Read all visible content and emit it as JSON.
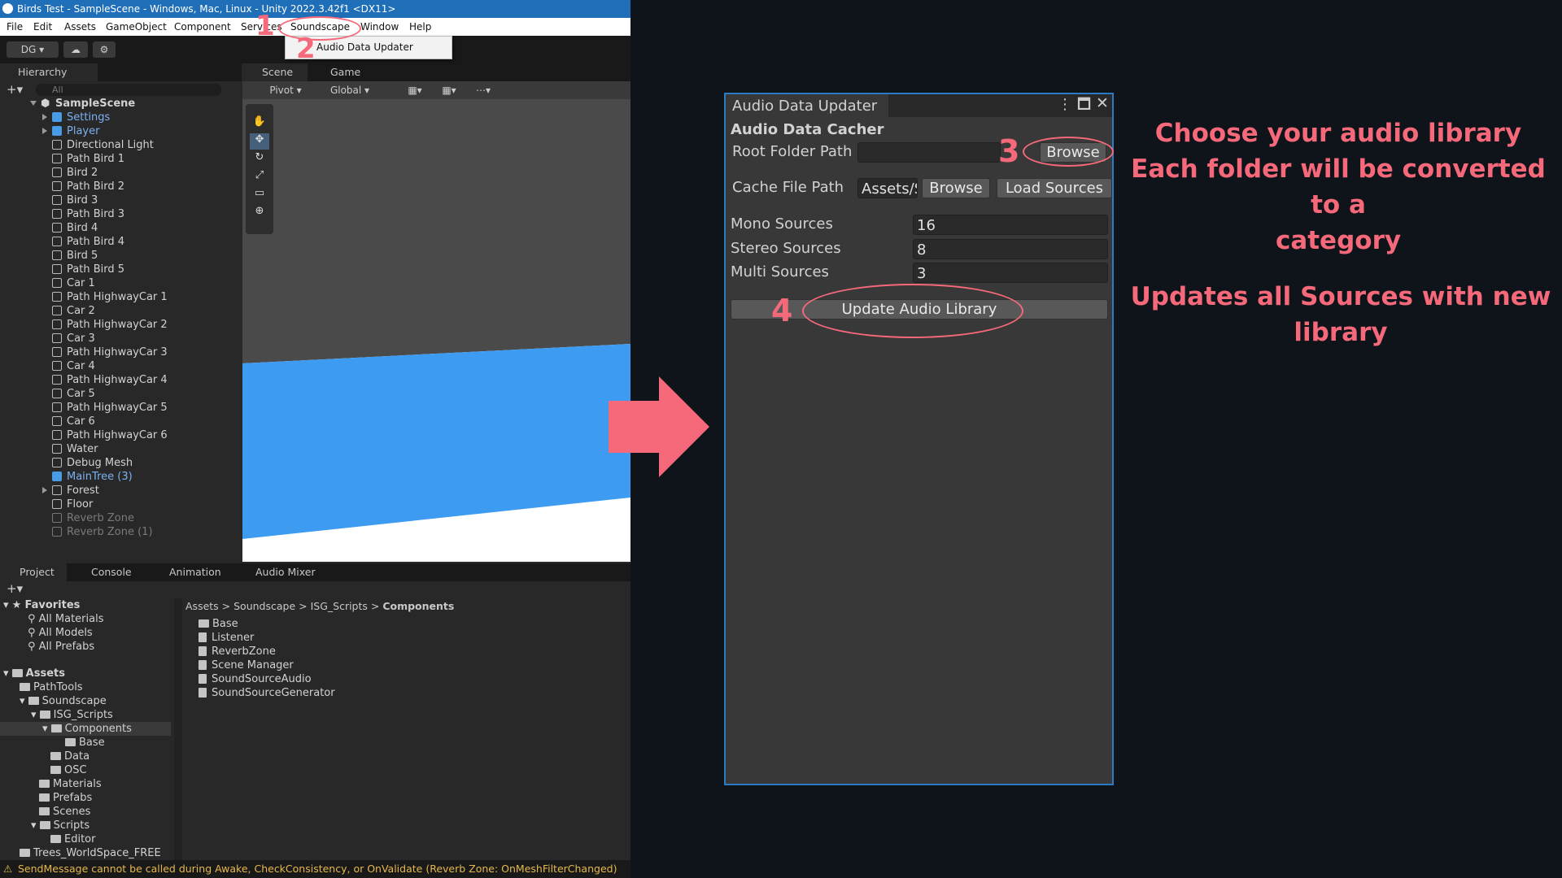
{
  "window": {
    "title": "Birds Test - SampleScene - Windows, Mac, Linux - Unity 2022.3.42f1 <DX11>"
  },
  "menu": [
    "File",
    "Edit",
    "Assets",
    "GameObject",
    "Component",
    "Services",
    "Soundscape",
    "Window",
    "Help"
  ],
  "dropdown": {
    "item": "Audio Data Updater"
  },
  "toolbar": {
    "account": "DG"
  },
  "hierarchy": {
    "tab": "Hierarchy",
    "search_placeholder": "All",
    "scene": "SampleScene",
    "items": [
      "Settings",
      "Player",
      "Directional Light",
      "Path Bird 1",
      "Bird 2",
      "Path Bird 2",
      "Bird 3",
      "Path Bird 3",
      "Bird 4",
      "Path Bird 4",
      "Bird 5",
      "Path Bird 5",
      "Car 1",
      "Path HighwayCar 1",
      "Car 2",
      "Path HighwayCar 2",
      "Car 3",
      "Path HighwayCar 3",
      "Car 4",
      "Path HighwayCar 4",
      "Car 5",
      "Path HighwayCar 5",
      "Car 6",
      "Path HighwayCar 6",
      "Water",
      "Debug Mesh",
      "MainTree (3)",
      "Forest",
      "Floor",
      "Reverb Zone",
      "Reverb Zone (1)"
    ]
  },
  "scene_panel": {
    "tab_scene": "Scene",
    "tab_game": "Game",
    "pivot": "Pivot",
    "global": "Global"
  },
  "bottom_tabs": [
    "Project",
    "Console",
    "Animation",
    "Audio Mixer"
  ],
  "project": {
    "favorites_label": "Favorites",
    "favorites": [
      "All Materials",
      "All Models",
      "All Prefabs"
    ],
    "assets_label": "Assets",
    "tree": [
      "PathTools",
      "Soundscape",
      "ISG_Scripts",
      "Components",
      "Base",
      "Data",
      "OSC",
      "Materials",
      "Prefabs",
      "Scenes",
      "Scripts",
      "Editor",
      "Trees_WorldSpace_FREE"
    ],
    "breadcrumb": [
      "Assets",
      "Soundscape",
      "ISG_Scripts",
      "Components"
    ],
    "files": [
      "Base",
      "Listener",
      "ReverbZone",
      "Scene Manager",
      "SoundSourceAudio",
      "SoundSourceGenerator"
    ]
  },
  "status": "SendMessage cannot be called during Awake, CheckConsistency, or OnValidate (Reverb Zone: OnMeshFilterChanged)",
  "audio_window": {
    "title": "Audio Data Updater",
    "section": "Audio Data Cacher",
    "root_label": "Root Folder Path",
    "root_value": "",
    "browse": "Browse",
    "cache_label": "Cache File Path",
    "cache_value": "Assets/Soundscape",
    "load": "Load Sources",
    "mono_label": "Mono Sources",
    "mono": "16",
    "stereo_label": "Stereo Sources",
    "stereo": "8",
    "multi_label": "Multi Sources",
    "multi": "3",
    "update": "Update Audio Library"
  },
  "annotations": {
    "n1": "1",
    "n2": "2",
    "n3": "3",
    "n4": "4",
    "note1_l1": "Choose your audio library",
    "note1_l2": "Each folder will be converted to a",
    "note1_l3": "category",
    "note2_l1": "Updates all Sources with new",
    "note2_l2": "library",
    "accent": "#f5697a"
  }
}
